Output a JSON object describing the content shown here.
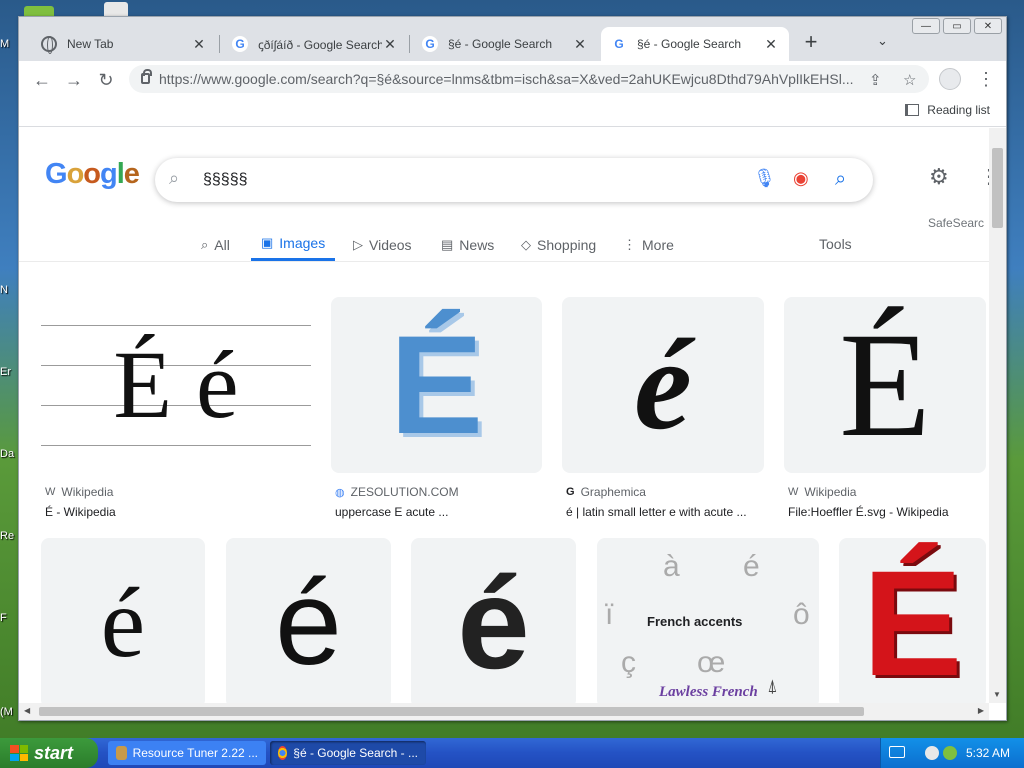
{
  "browser": {
    "tabs": [
      {
        "title": "New Tab",
        "favicon": "globe-icon",
        "active": false
      },
      {
        "title": "ꞔðíʃáíð - Google Search",
        "favicon": "google-icon",
        "active": false
      },
      {
        "title": "§é - Google Search",
        "favicon": "google-icon",
        "active": false
      },
      {
        "title": "§é - Google Search",
        "favicon": "google-icon",
        "active": true
      }
    ],
    "new_tab_symbol": "+",
    "tab_search_symbol": "⌄",
    "close_symbol": "✕",
    "url": "https://www.google.com/search?q=§é&source=lnms&tbm=isch&sa=X&ved=2ahUKEwjcu8Dthd79AhVplIkEHSl...",
    "reading_list_label": "Reading list"
  },
  "google": {
    "logo_letters": [
      "G",
      "o",
      "o",
      "g",
      "l",
      "e"
    ],
    "logo_colors": [
      "#4285f4",
      "#d9a23a",
      "#c65a1e",
      "#4285f4",
      "#34a853",
      "#b5651d"
    ],
    "query": "§§§§§",
    "tabs": [
      {
        "label": "All",
        "icon": "⌕"
      },
      {
        "label": "Images",
        "icon": "▣"
      },
      {
        "label": "Videos",
        "icon": "▷"
      },
      {
        "label": "News",
        "icon": "▤"
      },
      {
        "label": "Shopping",
        "icon": "◇"
      },
      {
        "label": "More",
        "icon": "⋮"
      }
    ],
    "tools_label": "Tools",
    "safesearch_label": "SafeSearc"
  },
  "results": [
    {
      "glyph": "É é",
      "source": "Wikipedia",
      "source_icon": "W",
      "title": "É - Wikipedia"
    },
    {
      "glyph": "É",
      "source": "ZESOLUTION.COM",
      "source_icon": "◍",
      "title": "uppercase E acute ..."
    },
    {
      "glyph": "é",
      "source": "Graphemica",
      "source_icon": "G",
      "title": "é | latin small letter e with acute ..."
    },
    {
      "glyph": "É",
      "source": "Wikipedia",
      "source_icon": "W",
      "title": "File:Hoeffler É.svg - Wikipedia"
    },
    {
      "glyph": "é"
    },
    {
      "glyph": "é"
    },
    {
      "glyph": "é"
    },
    {
      "glyph_accents": [
        "à",
        "é",
        "ï",
        "ô",
        "ç",
        "œ"
      ],
      "caption": "French accents",
      "brand": "Lawless French"
    },
    {
      "glyph": "É"
    }
  ],
  "taskbar": {
    "start_label": "start",
    "tasks": [
      {
        "label": "Resource Tuner 2.22 ...",
        "active": false
      },
      {
        "label": "§é - Google Search - ...",
        "active": true
      }
    ],
    "clock": "5:32 AM"
  }
}
